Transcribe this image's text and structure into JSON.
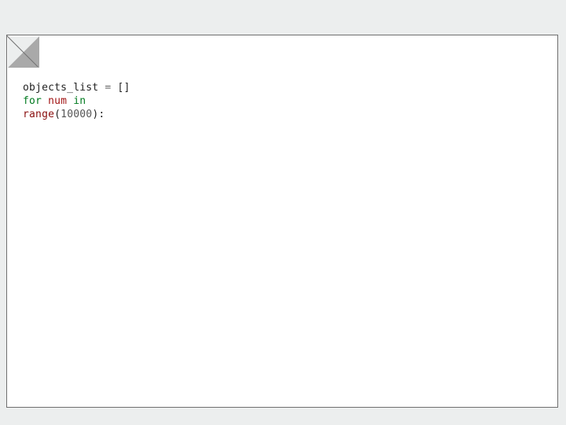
{
  "code": {
    "line1": {
      "objects_list": "objects_list",
      "eq": "=",
      "brackets": "[]"
    },
    "line2": {
      "for": "for",
      "num": "num",
      "in": "in"
    },
    "line3": {
      "range": "range",
      "open": "(",
      "n": "10000",
      "close": ")",
      "colon": ":"
    }
  }
}
